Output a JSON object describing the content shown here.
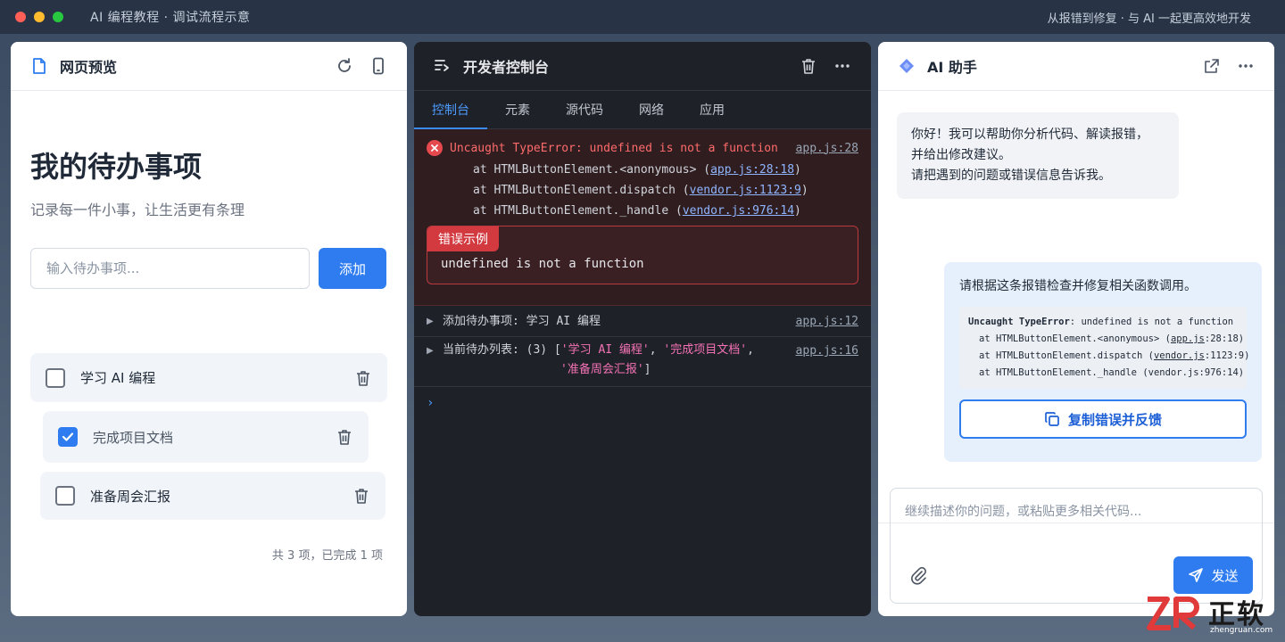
{
  "window": {
    "title_left": "AI 编程教程 · 调试流程示意",
    "title_right": "从报错到修复 · 与 AI 一起更高效地开发"
  },
  "preview": {
    "panel_title": "网页预览",
    "heading": "我的待办事项",
    "subheading": "记录每一件小事，让生活更有条理",
    "input_placeholder": "输入待办事项...",
    "add_label": "添加",
    "items": [
      {
        "text": "学习 AI 编程",
        "checked": false
      },
      {
        "text": "完成项目文档",
        "checked": true
      },
      {
        "text": "准备周会汇报",
        "checked": false
      }
    ],
    "summary": "共 3 项，已完成 1 项"
  },
  "console": {
    "panel_title": "开发者控制台",
    "tabs": [
      "控制台",
      "元素",
      "源代码",
      "网络",
      "应用"
    ],
    "error": {
      "message": "Uncaught TypeError: undefined is not a function",
      "source": "app.js:28",
      "stack": [
        {
          "prefix": "at HTMLButtonElement.<anonymous> (",
          "link": "app.js:28:18",
          "suffix": ")"
        },
        {
          "prefix": "at HTMLButtonElement.dispatch (",
          "link": "vendor.js:1123:9",
          "suffix": ")"
        },
        {
          "prefix": "at HTMLButtonElement._handle (",
          "link": "vendor.js:976:14",
          "suffix": ")"
        }
      ],
      "example_tag": "错误示例",
      "example_text": "undefined is not a function"
    },
    "logs": [
      {
        "text": "添加待办事项: 学习 AI 编程",
        "source": "app.js:12"
      },
      {
        "prefix": "当前待办列表: (3) [",
        "items": [
          "'学习 AI 编程'",
          "'完成项目文档'",
          "'准备周会汇报'"
        ],
        "suffix": "]",
        "source": "app.js:16"
      }
    ],
    "prompt": "›"
  },
  "assistant": {
    "panel_title": "AI 助手",
    "greeting": [
      "你好！我可以帮助你分析代码、解读报错，",
      "并给出修改建议。",
      "请把遇到的问题或错误信息告诉我。"
    ],
    "user_request": "请根据这条报错检查并修复相关函数调用。",
    "code": {
      "line1_bold": "Uncaught TypeError",
      "line1_rest": ": undefined is not a function",
      "line2_a": "at HTMLButtonElement.<anonymous> (",
      "line2_link": "app.js",
      "line2_b": ":28:18)",
      "line3_a": "at HTMLButtonElement.dispatch (",
      "line3_link": "vendor.js",
      "line3_b": ":1123:9)",
      "line4": "at HTMLButtonElement._handle (vendor.js:976:14)"
    },
    "copy_label": "复制错误并反馈",
    "composer_placeholder": "继续描述你的问题，或粘贴更多相关代码...",
    "send_label": "发送"
  },
  "watermark": {
    "brand": "正软",
    "url": "zhengruan.com"
  },
  "colors": {
    "accent": "#2f7cf0",
    "error": "#e5484d",
    "console_bg": "#1e2127"
  }
}
